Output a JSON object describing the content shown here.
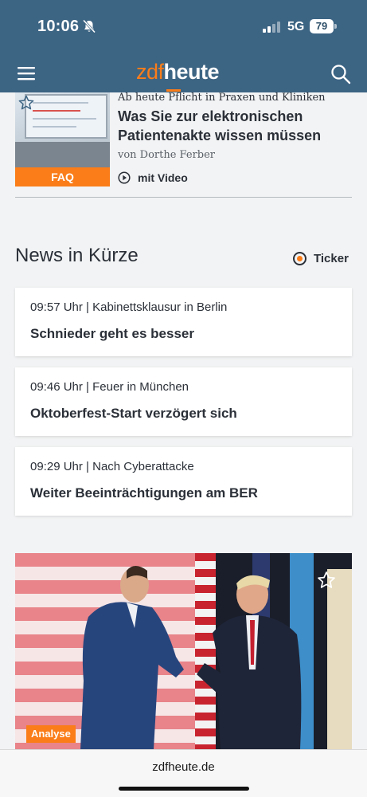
{
  "status_bar": {
    "time": "10:06",
    "network": "5G",
    "battery": "79"
  },
  "header": {
    "logo_zdf": "zdf",
    "logo_heute": "heute"
  },
  "top_article": {
    "badge": "FAQ",
    "kicker": "Ab heute Pflicht in Praxen und Kliniken",
    "headline": "Was Sie zur elektronischen Patientenakte wissen müssen",
    "author": "von Dorthe Ferber",
    "media_label": "mit Video"
  },
  "news_section": {
    "title": "News in Kürze",
    "ticker_label": "Ticker",
    "items": [
      {
        "meta": "09:57 Uhr | Kabinettsklausur in Berlin",
        "title": "Schnieder geht es besser"
      },
      {
        "meta": "09:46 Uhr | Feuer in München",
        "title": "Oktoberfest-Start verzögert sich"
      },
      {
        "meta": "09:29 Uhr | Nach Cyberattacke",
        "title": "Weiter Beeinträchtigungen am BER"
      }
    ]
  },
  "feature_article": {
    "badge": "Analyse"
  },
  "browser": {
    "url": "zdfheute.de"
  },
  "colors": {
    "brand_blue": "#3c6483",
    "accent_orange": "#fa7d19",
    "text_dark": "#2b3038"
  }
}
